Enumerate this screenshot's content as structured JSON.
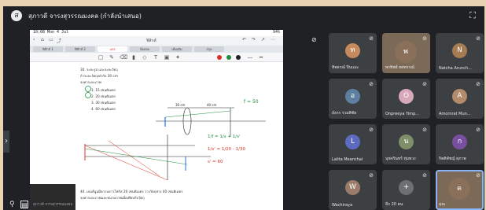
{
  "meet": {
    "presenter_initial": "ส",
    "presenter_title": "สุภาวดี จารงสุวรรณมงคล (กำลังนำเสนอ)",
    "fullscreen_icon": "fullscreen-icon",
    "stage_caption": "สุภาวดี จารงสุวรรณมงคล",
    "pin_icon": "pin-icon",
    "present_icon": "present-to-all-icon"
  },
  "stage": {
    "status": {
      "time": "10:08",
      "date": "Mon 4 Jul",
      "battery": "94%"
    },
    "doc_title": "ฟิสิกส์",
    "toolbar_left": [
      "‹",
      "⌂",
      "▭",
      "⤴"
    ],
    "toolbar_right": [
      "↶",
      "↷",
      "↗",
      "⋯"
    ],
    "tabs": [
      "ฟิสิกส์ 1",
      "ฟิสิกส์ 2",
      "แสง",
      "ข้อสอบ",
      "เพิ่มเติม",
      "สรุป"
    ],
    "active_tab_index": 2,
    "pen_colors": [
      "#d93025",
      "#1e8e3e",
      "#202124"
    ],
    "question_lines": [
      "30. ระยะรูป และระยะวัตถุ",
      "ถ้าระยะวัตถุเท่ากับ 30 cm",
      "จงหาระยะภาพ",
      "1. 15 เซนติเมตร",
      "2. 20 เซนติเมตร",
      "3. 30 เซนติเมตร",
      "4. 60 เซนติเมตร"
    ],
    "dimension_labels": [
      "30 cm",
      "40 cm"
    ],
    "focal_label": "f = 50",
    "formula_lines": [
      "1/f = 1/s + 1/s'",
      "1/s' = 1/20 - 1/30",
      "s' = 60"
    ],
    "footer_line": "40. เลนส์นูนมีความยาวโฟกัส 20 เซนติเมตร วางวัตถุห่าง 40 เซนติเมตร",
    "footer_line2": "จงหาระยะภาพและขนาดภาพเมื่อเทียบกับวัตถุ"
  },
  "participants": [
    {
      "name": "ทิพธรณ์ ปิ่นแมะ",
      "initial": "ท",
      "avatar_color": "#c58b5f",
      "type": "avatar"
    },
    {
      "name": "พรทิพย์ ทศพรรณ์",
      "initial": "พ",
      "avatar_color": "#8a6f5a",
      "type": "video"
    },
    {
      "name": "Natcha Arunch...",
      "initial": "N",
      "avatar_color": "#a67c52",
      "type": "avatar"
    },
    {
      "name": "อังกร รวมพิชัย",
      "initial": "อ",
      "avatar_color": "#5f7fa0",
      "type": "avatar"
    },
    {
      "name": "Onpreeya Yimp...",
      "initial": "O",
      "avatar_color": "#d7a9b8",
      "type": "avatar"
    },
    {
      "name": "Amornrat Mun...",
      "initial": "A",
      "avatar_color": "#b38b6d",
      "type": "avatar"
    },
    {
      "name": "Lalita Meanchai",
      "initial": "L",
      "avatar_color": "#5c6bc0",
      "type": "avatar"
    },
    {
      "name": "นุชจรินทร์ ทุ่มพวง",
      "initial": "น",
      "avatar_color": "#7e8f6a",
      "type": "avatar"
    },
    {
      "name": "กิตติพัชญ์ สุภาพ",
      "initial": "ก",
      "avatar_color": "#7b4fa0",
      "type": "avatar"
    },
    {
      "name": "Wachiraya",
      "initial": "W",
      "avatar_color": "#9b7c6a",
      "type": "avatar"
    },
    {
      "name": "อีก 20 คน",
      "initial": "+",
      "avatar_color": "#6d6f73",
      "type": "avatar"
    },
    {
      "name": "คุณ",
      "initial": "ค",
      "avatar_color": "#8a6f5a",
      "type": "video"
    }
  ]
}
